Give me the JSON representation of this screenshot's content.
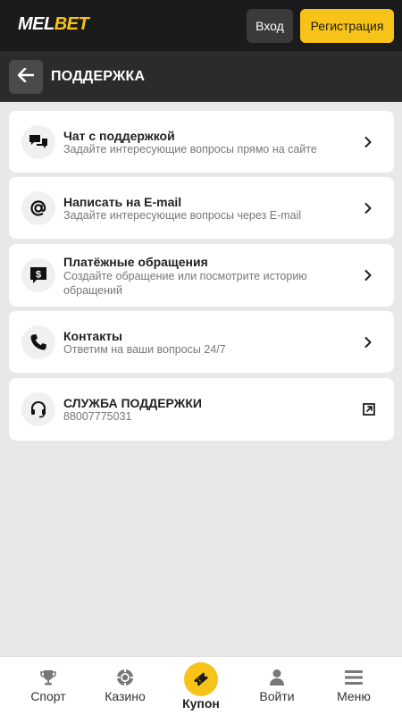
{
  "topbar": {
    "logo_part1": "MEL",
    "logo_part2": "BET",
    "login_label": "Вход",
    "register_label": "Регистрация"
  },
  "header": {
    "title": "ПОДДЕРЖКА",
    "back_icon": "arrow-left-icon"
  },
  "items": [
    {
      "title": "Чат с поддержкой",
      "subtitle": "Задайте интересующие вопросы прямо на сайте",
      "icon": "chat-icon",
      "action": "chevron-right-icon"
    },
    {
      "title": "Написать на E-mail",
      "subtitle": "Задайте интересующие вопросы через E-mail",
      "icon": "at-icon",
      "action": "chevron-right-icon"
    },
    {
      "title": "Платёжные обращения",
      "subtitle": "Создайте обращение или посмотрите историю обращений",
      "icon": "payment-icon",
      "action": "chevron-right-icon"
    },
    {
      "title": "Контакты",
      "subtitle": "Ответим на ваши вопросы 24/7",
      "icon": "phone-icon",
      "action": "chevron-right-icon"
    },
    {
      "title": "СЛУЖБА ПОДДЕРЖКИ",
      "subtitle": "88007775031",
      "icon": "headset-icon",
      "action": "external-link-icon"
    }
  ],
  "bottom_nav": [
    {
      "label": "Спорт",
      "icon": "trophy-icon"
    },
    {
      "label": "Казино",
      "icon": "casino-chip-icon"
    },
    {
      "label": "Купон",
      "icon": "ticket-icon"
    },
    {
      "label": "Войти",
      "icon": "user-icon"
    },
    {
      "label": "Меню",
      "icon": "menu-icon"
    }
  ],
  "colors": {
    "accent": "#f8c318",
    "topbar": "#1b1b1b",
    "headerbar": "#2b2b2b",
    "background": "#e8e8e8"
  }
}
